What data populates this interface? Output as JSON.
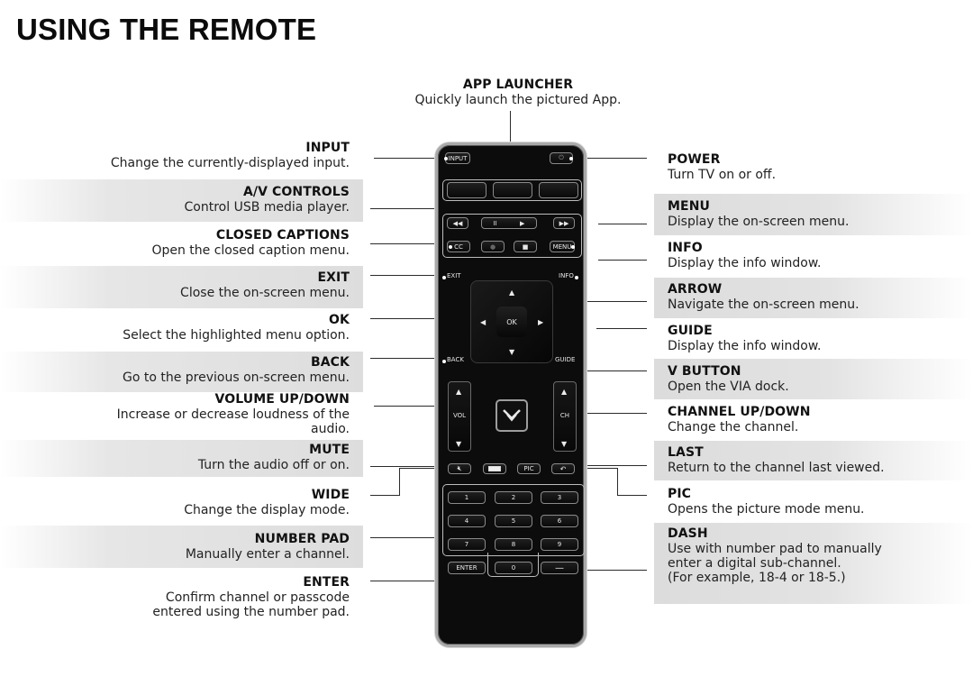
{
  "page": {
    "title": "USING THE REMOTE"
  },
  "app_launcher": {
    "title": "APP LAUNCHER",
    "description": "Quickly launch the pictured App."
  },
  "left_callouts": [
    {
      "id": "input",
      "title": "INPUT",
      "lines": [
        "Change the currently-displayed input."
      ],
      "shaded": false
    },
    {
      "id": "av-controls",
      "title": "A/V CONTROLS",
      "lines": [
        "Control USB media player."
      ],
      "shaded": true
    },
    {
      "id": "closed-captions",
      "title": "CLOSED CAPTIONS",
      "lines": [
        "Open the closed caption menu."
      ],
      "shaded": false
    },
    {
      "id": "exit",
      "title": "EXIT",
      "lines": [
        "Close the on-screen menu."
      ],
      "shaded": true
    },
    {
      "id": "ok",
      "title": "OK",
      "lines": [
        "Select the highlighted menu option."
      ],
      "shaded": false
    },
    {
      "id": "back",
      "title": "BACK",
      "lines": [
        "Go to the previous on-screen menu."
      ],
      "shaded": true
    },
    {
      "id": "volume",
      "title": "VOLUME UP/DOWN",
      "lines": [
        "Increase or decrease loudness of the",
        "audio."
      ],
      "shaded": false
    },
    {
      "id": "mute",
      "title": "MUTE",
      "lines": [
        "Turn the audio off or on."
      ],
      "shaded": true
    },
    {
      "id": "wide",
      "title": "WIDE",
      "lines": [
        "Change the display mode."
      ],
      "shaded": false
    },
    {
      "id": "number-pad",
      "title": "NUMBER PAD",
      "lines": [
        "Manually enter a channel."
      ],
      "shaded": true
    },
    {
      "id": "enter",
      "title": "ENTER",
      "lines": [
        "Confirm channel or passcode",
        "entered using the number pad."
      ],
      "shaded": false
    }
  ],
  "right_callouts": [
    {
      "id": "power",
      "title": "POWER",
      "lines": [
        "Turn TV on or off."
      ],
      "shaded": false
    },
    {
      "id": "menu",
      "title": "MENU",
      "lines": [
        "Display the on-screen menu."
      ],
      "shaded": true
    },
    {
      "id": "info",
      "title": "INFO",
      "lines": [
        "Display the info window."
      ],
      "shaded": false
    },
    {
      "id": "arrow",
      "title": "ARROW",
      "lines": [
        "Navigate the on-screen menu."
      ],
      "shaded": true
    },
    {
      "id": "guide",
      "title": "GUIDE",
      "lines": [
        "Display the info window."
      ],
      "shaded": false
    },
    {
      "id": "v-button",
      "title": "V BUTTON",
      "lines": [
        "Open the VIA dock."
      ],
      "shaded": true
    },
    {
      "id": "channel",
      "title": "CHANNEL UP/DOWN",
      "lines": [
        "Change the channel."
      ],
      "shaded": false
    },
    {
      "id": "last",
      "title": "LAST",
      "lines": [
        "Return to the channel last viewed."
      ],
      "shaded": true
    },
    {
      "id": "pic",
      "title": "PIC",
      "lines": [
        "Opens the picture mode menu."
      ],
      "shaded": false
    },
    {
      "id": "dash",
      "title": "DASH",
      "lines": [
        "Use with number pad to manually",
        "enter a digital sub-channel.",
        "(For example, 18-4 or 18-5.)"
      ],
      "shaded": true
    }
  ],
  "remote": {
    "buttons": {
      "input": "INPUT",
      "cc": "CC",
      "menu": "MENU",
      "exit": "EXIT",
      "info": "INFO",
      "ok": "OK",
      "back": "BACK",
      "guide": "GUIDE",
      "vol": "VOL",
      "ch": "CH",
      "pic": "PIC",
      "enter": "ENTER",
      "numbers": [
        "1",
        "2",
        "3",
        "4",
        "5",
        "6",
        "7",
        "8",
        "9",
        "0"
      ]
    },
    "icons": {
      "rewind": "◀◀",
      "pause": "II",
      "play": "▶",
      "fast_forward": "▶▶",
      "record": "●",
      "stop": "■",
      "up": "▲",
      "down": "▼",
      "left": "◀",
      "right": "▶",
      "power": "⏻",
      "dash": "—"
    }
  }
}
